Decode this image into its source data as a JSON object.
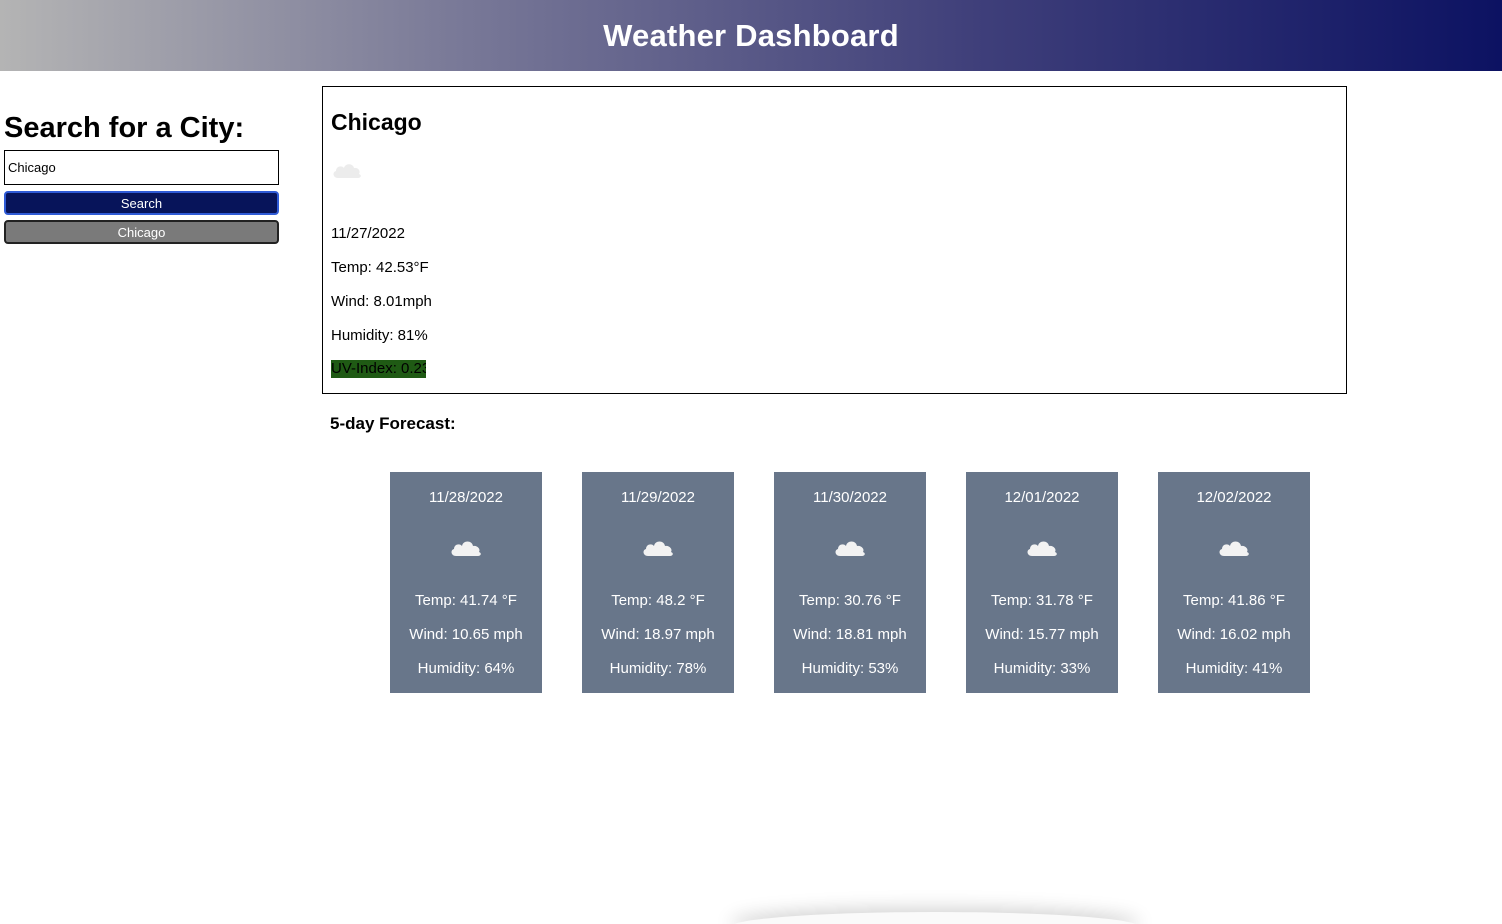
{
  "header": {
    "title": "Weather Dashboard"
  },
  "sidebar": {
    "heading": "Search for a City:",
    "search_value": "Chicago",
    "search_button": "Search",
    "history": [
      "Chicago"
    ]
  },
  "current": {
    "city": "Chicago",
    "icon": "cloud-icon",
    "date": "11/27/2022",
    "temp": "Temp: 42.53°F",
    "wind": "Wind: 8.01mph",
    "humidity": "Humidity: 81%",
    "uv": "UV-Index: 0.23",
    "uv_color": "#1f5a14"
  },
  "forecast": {
    "title": "5-day Forecast:",
    "card_color": "#68768a",
    "days": [
      {
        "date": "11/28/2022",
        "icon": "cloud-icon",
        "temp": "Temp: 41.74 °F",
        "wind": "Wind: 10.65 mph",
        "humidity": "Humidity: 64%"
      },
      {
        "date": "11/29/2022",
        "icon": "cloud-icon",
        "temp": "Temp: 48.2 °F",
        "wind": "Wind: 18.97 mph",
        "humidity": "Humidity: 78%"
      },
      {
        "date": "11/30/2022",
        "icon": "cloud-icon",
        "temp": "Temp: 30.76 °F",
        "wind": "Wind: 18.81 mph",
        "humidity": "Humidity: 53%"
      },
      {
        "date": "12/01/2022",
        "icon": "cloud-icon",
        "temp": "Temp: 31.78 °F",
        "wind": "Wind: 15.77 mph",
        "humidity": "Humidity: 33%"
      },
      {
        "date": "12/02/2022",
        "icon": "cloud-icon",
        "temp": "Temp: 41.86 °F",
        "wind": "Wind: 16.02 mph",
        "humidity": "Humidity: 41%"
      }
    ]
  }
}
